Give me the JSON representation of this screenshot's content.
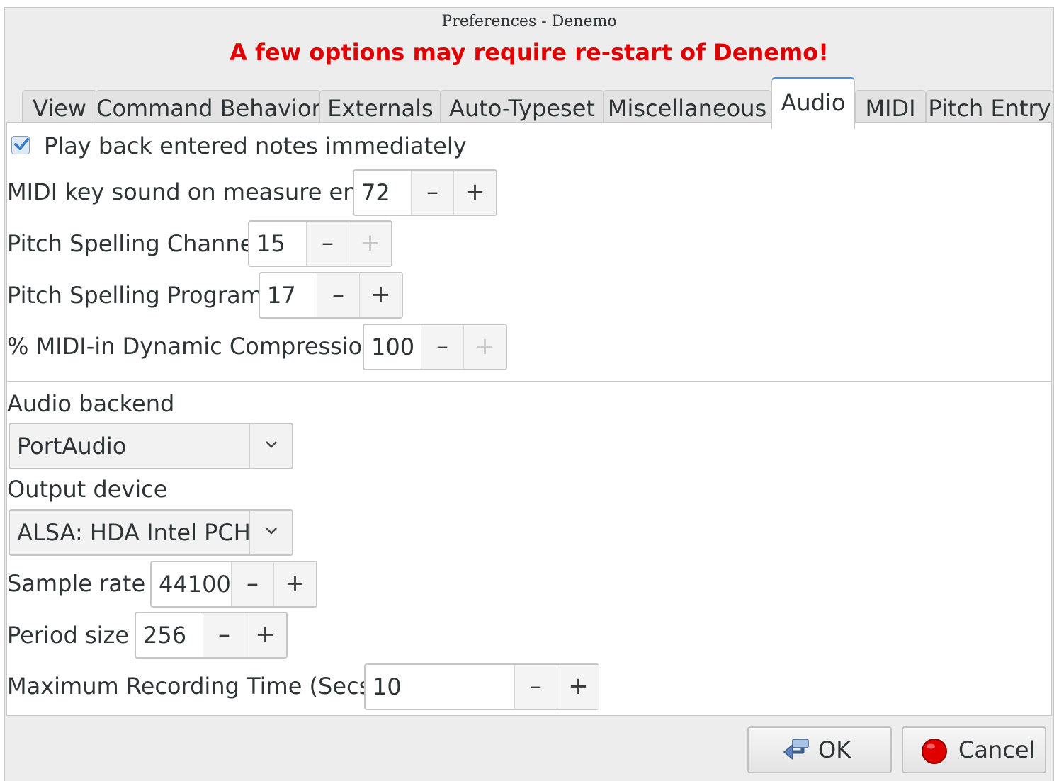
{
  "window": {
    "title": "Preferences - Denemo",
    "warning": "A few options may require re-start of Denemo!"
  },
  "tabs": [
    {
      "label": "View"
    },
    {
      "label": "Command Behavior"
    },
    {
      "label": "Externals"
    },
    {
      "label": "Auto-Typeset"
    },
    {
      "label": "Miscellaneous"
    },
    {
      "label": "Audio",
      "active": true
    },
    {
      "label": "MIDI"
    },
    {
      "label": "Pitch Entry"
    }
  ],
  "audio": {
    "playback_checkbox": {
      "label": "Play back entered notes immediately",
      "checked": true
    },
    "midi_key_sound": {
      "label": "MIDI key sound on measure end",
      "value": "72"
    },
    "pitch_spelling_channel": {
      "label": "Pitch Spelling Channel",
      "value": "15"
    },
    "pitch_spelling_program": {
      "label": "Pitch Spelling Program",
      "value": "17"
    },
    "dynamic_compression": {
      "label": "% MIDI-in Dynamic Compression",
      "value": "100"
    },
    "audio_backend": {
      "label": "Audio backend",
      "selected": "PortAudio"
    },
    "output_device": {
      "label": "Output device",
      "selected": "ALSA: HDA Intel PCH"
    },
    "sample_rate": {
      "label": "Sample rate",
      "value": "44100"
    },
    "period_size": {
      "label": "Period size",
      "value": "256"
    },
    "max_recording_time": {
      "label": "Maximum Recording Time (Secs)",
      "value": "10"
    }
  },
  "spin_symbols": {
    "minus": "–",
    "plus": "+"
  },
  "buttons": {
    "ok": "OK",
    "cancel": "Cancel"
  },
  "colors": {
    "warning": "#e00000",
    "accent": "#4a90d9",
    "cancel_icon": "#e00000"
  }
}
